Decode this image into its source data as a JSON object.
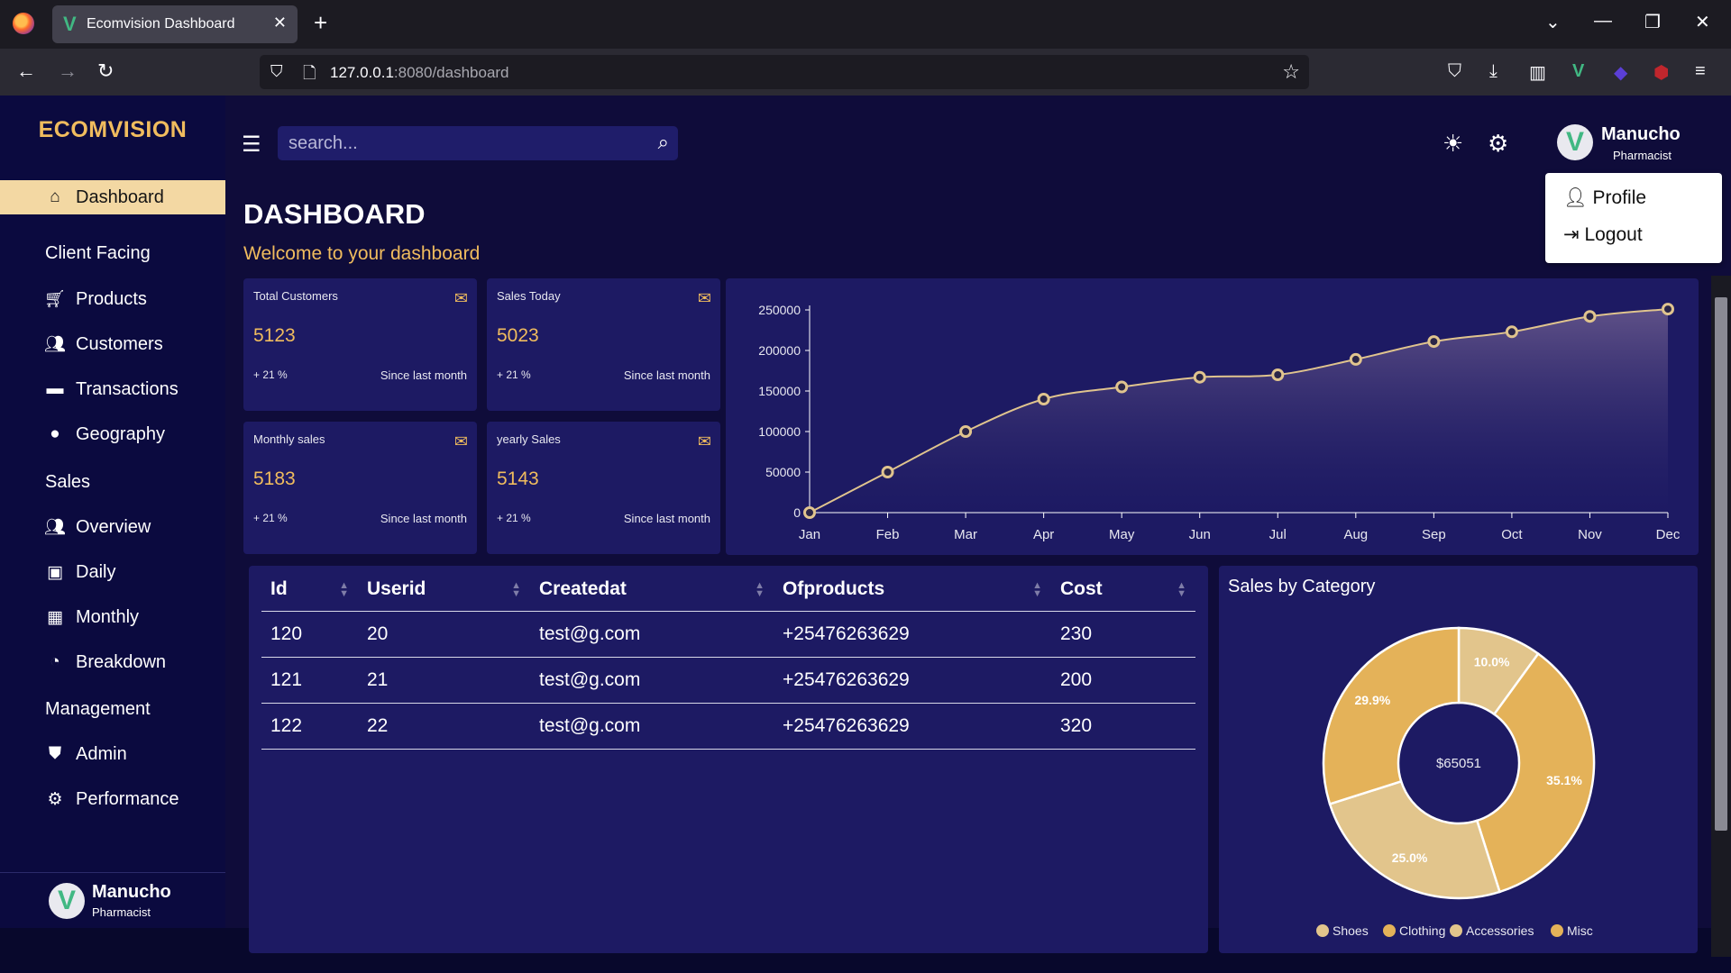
{
  "browser": {
    "tab_title": "Ecomvision Dashboard",
    "tab_icon": "vue-logo-icon",
    "url_host": "127.0.0.1",
    "url_rest": ":8080/dashboard"
  },
  "sidebar": {
    "brand": "ECOMVISION",
    "items": [
      {
        "type": "item",
        "label": "Dashboard",
        "icon": "home-icon",
        "active": true
      },
      {
        "type": "header",
        "label": "Client Facing"
      },
      {
        "type": "item",
        "label": "Products",
        "icon": "cart-icon"
      },
      {
        "type": "item",
        "label": "Customers",
        "icon": "users-icon"
      },
      {
        "type": "item",
        "label": "Transactions",
        "icon": "wallet-icon"
      },
      {
        "type": "item",
        "label": "Geography",
        "icon": "globe-icon"
      },
      {
        "type": "header",
        "label": "Sales"
      },
      {
        "type": "item",
        "label": "Overview",
        "icon": "users-icon"
      },
      {
        "type": "item",
        "label": "Daily",
        "icon": "calendar-day-icon"
      },
      {
        "type": "item",
        "label": "Monthly",
        "icon": "calendar-icon"
      },
      {
        "type": "item",
        "label": "Breakdown",
        "icon": "pie-icon"
      },
      {
        "type": "header",
        "label": "Management"
      },
      {
        "type": "item",
        "label": "Admin",
        "icon": "shield-icon"
      },
      {
        "type": "item",
        "label": "Performance",
        "icon": "gear-icon"
      }
    ],
    "user": {
      "name": "Manucho",
      "role": "Pharmacist"
    }
  },
  "topbar": {
    "search_placeholder": "search...",
    "user": {
      "name": "Manucho",
      "role": "Pharmacist"
    },
    "dropdown": {
      "profile": "Profile",
      "logout": "Logout"
    }
  },
  "page": {
    "title": "DASHBOARD",
    "subtitle": "Welcome to your dashboard"
  },
  "stats": [
    {
      "label": "Total Customers",
      "value": "5123",
      "change": "+ 21 %",
      "since": "Since last month"
    },
    {
      "label": "Sales Today",
      "value": "5023",
      "change": "+ 21 %",
      "since": "Since last month"
    },
    {
      "label": "Monthly sales",
      "value": "5183",
      "change": "+ 21 %",
      "since": "Since last month"
    },
    {
      "label": "yearly Sales",
      "value": "5143",
      "change": "+ 21 %",
      "since": "Since last month"
    }
  ],
  "table": {
    "columns": [
      "Id",
      "Userid",
      "Createdat",
      "Ofproducts",
      "Cost"
    ],
    "rows": [
      [
        "120",
        "20",
        "test@g.com",
        "+25476263629",
        "230"
      ],
      [
        "121",
        "21",
        "test@g.com",
        "+25476263629",
        "200"
      ],
      [
        "122",
        "22",
        "test@g.com",
        "+25476263629",
        "320"
      ]
    ]
  },
  "chart_data": [
    {
      "type": "area",
      "categories": [
        "Jan",
        "Feb",
        "Mar",
        "Apr",
        "May",
        "Jun",
        "Jul",
        "Aug",
        "Sep",
        "Oct",
        "Nov",
        "Dec"
      ],
      "values": [
        0,
        50000,
        100000,
        140000,
        155000,
        167000,
        170000,
        189000,
        211000,
        223000,
        242000,
        251000
      ],
      "ylim": [
        0,
        250000
      ],
      "yticks": [
        0,
        50000,
        100000,
        150000,
        200000,
        250000
      ],
      "color": "#e0c48e",
      "grid": false
    },
    {
      "type": "pie",
      "title": "Sales by Category",
      "center_label": "$65051",
      "slices": [
        {
          "name": "Misc",
          "value": 10.0,
          "label": "10.0%",
          "color": "#e2c58c"
        },
        {
          "name": "Clothing",
          "value": 35.1,
          "label": "35.1%",
          "color": "#e4b259"
        },
        {
          "name": "Shoes",
          "value": 25.0,
          "label": "25.0%",
          "color": "#e2c58c"
        },
        {
          "name": "Accessories",
          "value": 29.9,
          "label": "29.9%",
          "color": "#e4b259"
        }
      ],
      "legend": [
        {
          "name": "Shoes",
          "color": "#e2c58c"
        },
        {
          "name": "Clothing",
          "color": "#e4b259"
        },
        {
          "name": "Accessories",
          "color": "#e2c58c"
        },
        {
          "name": "Misc",
          "color": "#e4b259"
        }
      ],
      "legend_position": "bottom"
    }
  ]
}
